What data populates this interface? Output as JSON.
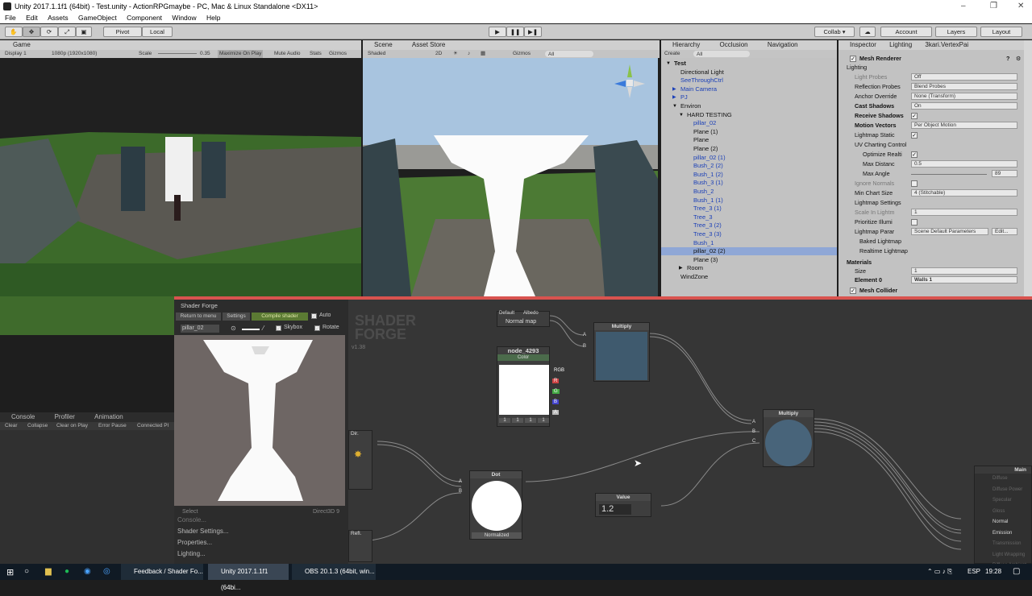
{
  "window": {
    "title": "Unity 2017.1.1f1 (64bit) - Test.unity - ActionRPGmaybe - PC, Mac & Linux Standalone <DX11>",
    "controls": [
      "–",
      "❐",
      "✕"
    ]
  },
  "menu": [
    "File",
    "Edit",
    "Assets",
    "GameObject",
    "Component",
    "Window",
    "Help"
  ],
  "toolbar": {
    "pivot": "Pivot",
    "local": "Local",
    "collab": "Collab ▾",
    "account": "Account",
    "layers": "Layers",
    "layout": "Layout"
  },
  "game_view": {
    "tab": "Game",
    "display": "Display 1",
    "resolution": "1080p (1920x1080)",
    "scale_label": "Scale",
    "scale_value": "0.35",
    "maximize": "Maximize On Play",
    "mute": "Mute Audio",
    "stats": "Stats",
    "gizmos": "Gizmos"
  },
  "scene_view": {
    "tab_scene": "Scene",
    "tab_asset_store": "Asset Store",
    "shaded": "Shaded",
    "mode_2d": "2D",
    "gizmos": "Gizmos",
    "search": "All"
  },
  "hierarchy": {
    "tab": "Hierarchy",
    "tab_occlusion": "Occlusion",
    "tab_navigation": "Navigation",
    "create": "Create",
    "search": "All",
    "items": [
      {
        "label": "Test",
        "depth": 0,
        "blue": false,
        "arrow": "▼"
      },
      {
        "label": "Directional Light",
        "depth": 1,
        "blue": false,
        "arrow": ""
      },
      {
        "label": "SeeThroughCtrl",
        "depth": 1,
        "blue": true,
        "arrow": ""
      },
      {
        "label": "Main Camera",
        "depth": 1,
        "blue": true,
        "arrow": "▶"
      },
      {
        "label": "PJ",
        "depth": 1,
        "blue": true,
        "arrow": "▶"
      },
      {
        "label": "Environ",
        "depth": 1,
        "blue": false,
        "arrow": "▼"
      },
      {
        "label": "HARD TESTING",
        "depth": 2,
        "blue": false,
        "arrow": "▼"
      },
      {
        "label": "pillar_02",
        "depth": 3,
        "blue": true,
        "arrow": ""
      },
      {
        "label": "Plane (1)",
        "depth": 3,
        "blue": false,
        "arrow": ""
      },
      {
        "label": "Plane",
        "depth": 3,
        "blue": false,
        "arrow": ""
      },
      {
        "label": "Plane (2)",
        "depth": 3,
        "blue": false,
        "arrow": ""
      },
      {
        "label": "pillar_02 (1)",
        "depth": 3,
        "blue": true,
        "arrow": ""
      },
      {
        "label": "Bush_2 (2)",
        "depth": 3,
        "blue": true,
        "arrow": ""
      },
      {
        "label": "Bush_1 (2)",
        "depth": 3,
        "blue": true,
        "arrow": ""
      },
      {
        "label": "Bush_3 (1)",
        "depth": 3,
        "blue": true,
        "arrow": ""
      },
      {
        "label": "Bush_2",
        "depth": 3,
        "blue": true,
        "arrow": ""
      },
      {
        "label": "Bush_1 (1)",
        "depth": 3,
        "blue": true,
        "arrow": ""
      },
      {
        "label": "Tree_3 (1)",
        "depth": 3,
        "blue": true,
        "arrow": ""
      },
      {
        "label": "Tree_3",
        "depth": 3,
        "blue": true,
        "arrow": ""
      },
      {
        "label": "Tree_3 (2)",
        "depth": 3,
        "blue": true,
        "arrow": ""
      },
      {
        "label": "Tree_3 (3)",
        "depth": 3,
        "blue": true,
        "arrow": ""
      },
      {
        "label": "Bush_1",
        "depth": 3,
        "blue": true,
        "arrow": ""
      },
      {
        "label": "pillar_02 (2)",
        "depth": 3,
        "blue": false,
        "arrow": "",
        "selected": true
      },
      {
        "label": "Plane (3)",
        "depth": 3,
        "blue": false,
        "arrow": ""
      },
      {
        "label": "Room",
        "depth": 2,
        "blue": false,
        "arrow": "▶"
      },
      {
        "label": "WindZone",
        "depth": 1,
        "blue": false,
        "arrow": ""
      }
    ]
  },
  "inspector": {
    "tab": "Inspector",
    "tab_lighting": "Lighting",
    "tab_vertex": "3kari.VertexPai",
    "component": "Mesh Renderer",
    "section_lighting": "Lighting",
    "rows": [
      {
        "label": "Light Probes",
        "value": "Off",
        "dim": true
      },
      {
        "label": "Reflection Probes",
        "value": "Blend Probes"
      },
      {
        "label": "Anchor Override",
        "value": "None (Transform)"
      },
      {
        "label": "Cast Shadows",
        "value": "On",
        "bold": true
      },
      {
        "label": "Receive Shadows",
        "check": true,
        "bold": true
      },
      {
        "label": "Motion Vectors",
        "value": "Per Object Motion",
        "bold": true
      },
      {
        "label": "Lightmap Static",
        "check": true
      },
      {
        "label": "UV Charting Control",
        "section": true
      },
      {
        "label": "Optimize Realti",
        "check": true,
        "indent": true
      },
      {
        "label": "Max Distanc",
        "value": "0.5",
        "indent": true
      },
      {
        "label": "Max Angle",
        "value": "89",
        "indent": true,
        "slider": true
      },
      {
        "label": "Ignore Normals",
        "check": false,
        "dim": true
      },
      {
        "label": "Min Chart Size",
        "value": "4 (Stitchable)"
      },
      {
        "label": "Lightmap Settings",
        "section": true
      },
      {
        "label": "Scale In Lightm",
        "value": "1",
        "dim": true
      },
      {
        "label": "Prioritize Illumi",
        "check": false
      },
      {
        "label": "Lightmap Parar",
        "value": "Scene Default Parameters",
        "edit": "Edit..."
      },
      {
        "label": "Baked Lightmap",
        "section": true,
        "collapsed": true
      },
      {
        "label": "Realtime Lightmap",
        "section": true,
        "collapsed": true
      }
    ],
    "materials": "Materials",
    "size_label": "Size",
    "size_value": "1",
    "element_label": "Element 0",
    "element_value": "Walls 1",
    "collider": "Mesh Collider"
  },
  "console": {
    "tab": "Console",
    "tab_profiler": "Profiler",
    "tab_animation": "Animation",
    "buttons": [
      "Clear",
      "Collapse",
      "Clear on Play",
      "Error Pause",
      "Connected Pl"
    ]
  },
  "shader_forge": {
    "tab": "Shader Forge",
    "return": "Return to menu",
    "settings": "Settings",
    "compile": "Compile shader",
    "auto": "Auto",
    "mesh": "pillar_02",
    "skybox": "Skybox",
    "rotate": "Rotate",
    "version": "v1.38",
    "logo": "SHADER FORGE",
    "select": "Select",
    "renderer": "Direct3D 9",
    "menus": [
      "Console...",
      "Shader Settings...",
      "Properties...",
      "Lighting..."
    ],
    "nodes": {
      "default": "Default",
      "albedo": "Albedo",
      "normal_map": "Normal map",
      "color_node": "node_4293",
      "color_sub": "Color",
      "color_ports": [
        "RGB",
        "R",
        "G",
        "B",
        "A"
      ],
      "color_values": [
        "1",
        "1",
        "1",
        "1"
      ],
      "multiply1": "Multiply",
      "multiply2": "Multiply",
      "dot": "Dot",
      "dot_mode": "Normalized",
      "value": "Value",
      "value_num": "1.2",
      "dir": "Dir.",
      "refl": "Refl.",
      "main": "Main",
      "main_inputs": [
        "Diffuse",
        "Diffuse Power",
        "Specular",
        "Gloss",
        "Normal",
        "Emission",
        "Transmission",
        "Light Wrapping",
        "Diffuse Ambient Light"
      ]
    }
  },
  "taskbar": {
    "items": [
      "Feedback / Shader Fo...",
      "Unity 2017.1.1f1 (64bi...",
      "OBS 20.1.3 (64bit, win..."
    ],
    "lang": "ESP",
    "time": "19:28"
  }
}
